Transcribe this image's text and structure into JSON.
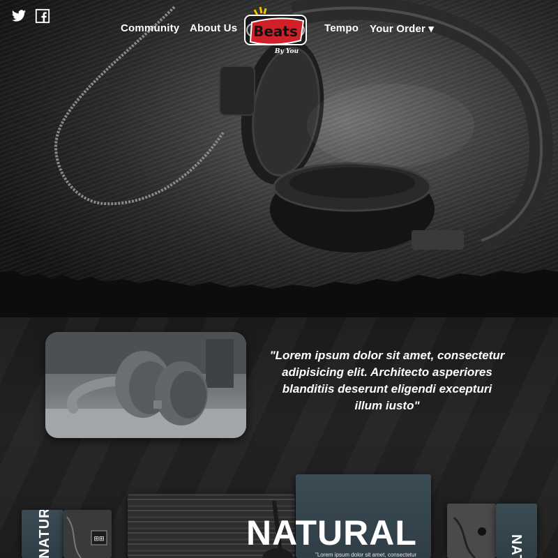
{
  "nav": {
    "social": [
      {
        "icon": "twitter-icon"
      },
      {
        "icon": "facebook-icon"
      }
    ],
    "links": {
      "community": "Community",
      "about": "About Us",
      "tempo": "Tempo",
      "order": "Your Order ▾"
    },
    "logo": {
      "text": "Beats",
      "tagline": "By You"
    }
  },
  "feature": {
    "quote": "\"Lorem ipsum dolor sit amet, consectetur adipisicing elit. Architecto asperiores blanditiis deserunt eligendi excepturi illum iusto\""
  },
  "cards": {
    "left_label": "NATURAL",
    "center_title": "NATURAL",
    "center_subtitle": "\"Lorem ipsum dolor sit amet, consectetur",
    "right_label": "NATU"
  },
  "colors": {
    "card_teal": "#3c4c54",
    "logo_red": "#d0202a",
    "text": "#ffffff"
  }
}
